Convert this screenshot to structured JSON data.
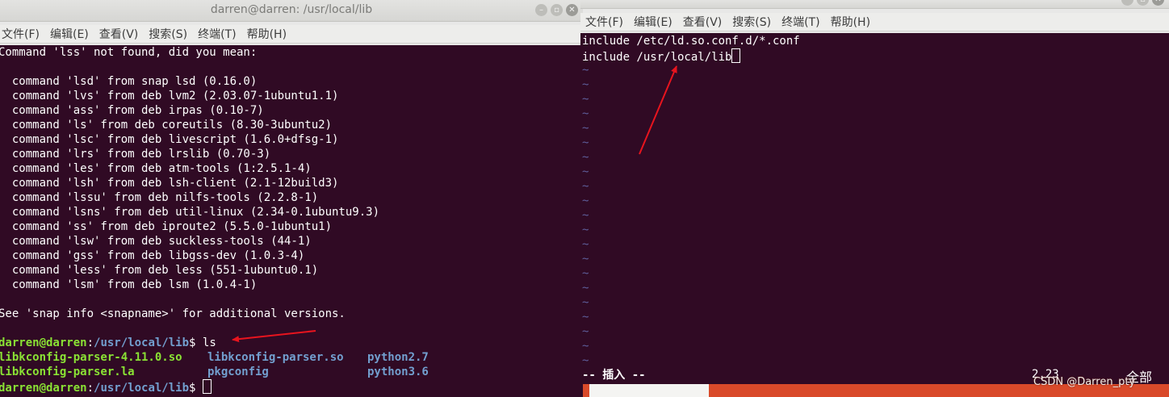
{
  "left_window": {
    "title": "darren@darren: /usr/local/lib",
    "menu": [
      "文件(F)",
      "编辑(E)",
      "查看(V)",
      "搜索(S)",
      "终端(T)",
      "帮助(H)"
    ],
    "lines": [
      "Command 'lss' not found, did you mean:",
      "",
      "  command 'lsd' from snap lsd (0.16.0)",
      "  command 'lvs' from deb lvm2 (2.03.07-1ubuntu1.1)",
      "  command 'ass' from deb irpas (0.10-7)",
      "  command 'ls' from deb coreutils (8.30-3ubuntu2)",
      "  command 'lsc' from deb livescript (1.6.0+dfsg-1)",
      "  command 'lrs' from deb lrslib (0.70-3)",
      "  command 'les' from deb atm-tools (1:2.5.1-4)",
      "  command 'lsh' from deb lsh-client (2.1-12build3)",
      "  command 'lssu' from deb nilfs-tools (2.2.8-1)",
      "  command 'lsns' from deb util-linux (2.34-0.1ubuntu9.3)",
      "  command 'ss' from deb iproute2 (5.5.0-1ubuntu1)",
      "  command 'lsw' from deb suckless-tools (44-1)",
      "  command 'gss' from deb libgss-dev (1.0.3-4)",
      "  command 'less' from deb less (551-1ubuntu0.1)",
      "  command 'lsm' from deb lsm (1.0.4-1)",
      "",
      "See 'snap info <snapname>' for additional versions.",
      ""
    ],
    "prompt_user": "darren@darren",
    "prompt_sep": ":",
    "prompt_path": "/usr/local/lib",
    "prompt_end": "$ ",
    "command": "ls",
    "files": [
      {
        "name": "libkconfig-parser-4.11.0.so",
        "color": "green"
      },
      {
        "name": "libkconfig-parser.so",
        "color": "blue"
      },
      {
        "name": "python2.7",
        "color": "blue"
      },
      {
        "name": "libkconfig-parser.la",
        "color": "green"
      },
      {
        "name": "pkgconfig",
        "color": "blue"
      },
      {
        "name": "python3.6",
        "color": "blue"
      }
    ]
  },
  "right_window": {
    "menu": [
      "文件(F)",
      "编辑(E)",
      "查看(V)",
      "搜索(S)",
      "终端(T)",
      "帮助(H)"
    ],
    "lines": [
      "include /etc/ld.so.conf.d/*.conf",
      "include /usr/local/lib"
    ],
    "tilde": "~",
    "mode": "-- 插入 --",
    "cursor_pos": "2,23",
    "scroll": "全部"
  },
  "watermark": "CSDN @Darren_pty",
  "colors": {
    "terminal_bg": "#300a24",
    "prompt_green": "#8ae234",
    "dir_blue": "#729fcf",
    "arrow_red": "#e8141e"
  }
}
